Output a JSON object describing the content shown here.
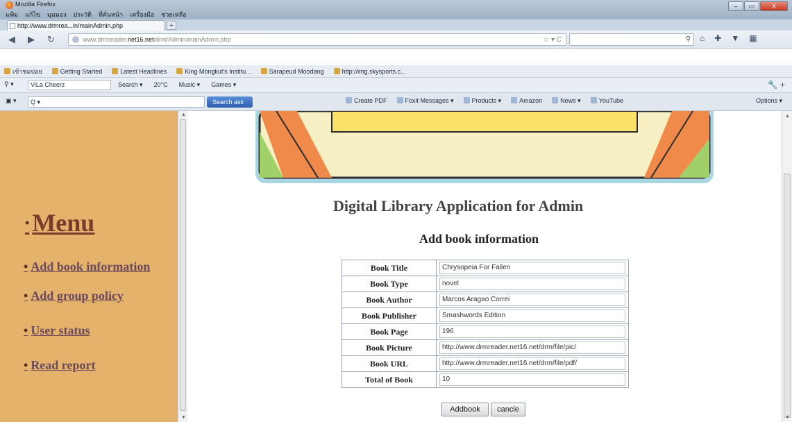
{
  "window": {
    "title": "Mozilla Firefox",
    "min": "–",
    "max": "▭",
    "close": "X"
  },
  "menubar": [
    "แฟ้ม",
    "แก้ไข",
    "มุมมอง",
    "ประวัติ",
    "ที่คั่นหน้า",
    "เครื่องมือ",
    "ช่วยเหลือ"
  ],
  "tab": {
    "label": "http://www.drmrea...in/mainAdmin.php",
    "new_tab": "+"
  },
  "navbar": {
    "back": "◀",
    "forward": "▶",
    "reload": "↻",
    "url_prefix": "www.drmreader.",
    "url_domain": "net16.net",
    "url_suffix": "/drm/Admin/mainAdmin.php",
    "url_tools": "☆ ▾ C",
    "search_icon": "⚲"
  },
  "bookmarks": [
    "เข้าชมบ่อย",
    "Getting Started",
    "Latest Headlines",
    "King Mongkut's Institu...",
    "Sarapeud Moodang",
    "http://img.skysports.c..."
  ],
  "toolbar1": {
    "profile_label": "⚲ ▾",
    "profile_value": "ViLa Cheerz",
    "items": [
      "Search ▾",
      "20°C",
      "Music ▾",
      "Games ▾"
    ],
    "tools": "🔧  +"
  },
  "toolbar2": {
    "search_placeholder": "Q ▾",
    "search_button": "Search ask",
    "items": [
      "Create PDF",
      "Foxit Messages ▾",
      "Products ▾",
      "Amazon",
      "News ▾",
      "YouTube"
    ],
    "options": "Options ▾"
  },
  "sidebar": {
    "title": "Menu",
    "links": [
      "Add book information",
      "Add group policy",
      "User status",
      "Read report"
    ]
  },
  "page": {
    "app_title": "Digital Library Application for Admin",
    "form_title": "Add book information"
  },
  "form": [
    {
      "label": "Book Title",
      "value": "Chrysopeia For Fallen"
    },
    {
      "label": "Book Type",
      "value": "novel"
    },
    {
      "label": "Book Author",
      "value": "Marcos Aragao Correi"
    },
    {
      "label": "Book Publisher",
      "value": "Smashwords Edition"
    },
    {
      "label": "Book Page",
      "value": "196"
    },
    {
      "label": "Book Picture",
      "value": "http://www.drmreader.net16.net/drm/file/pic/"
    },
    {
      "label": "Book URL",
      "value": "http://www.drmreader.net16.net/drm/file/pdf/"
    },
    {
      "label": "Total of Book",
      "value": "10"
    }
  ],
  "buttons": {
    "add": "Addbook",
    "cancel": "cancle"
  },
  "colors": {
    "sidebar": "#e5b26c",
    "menu_text": "#7a3a2c",
    "banner_frame": "#a8d7e3"
  }
}
